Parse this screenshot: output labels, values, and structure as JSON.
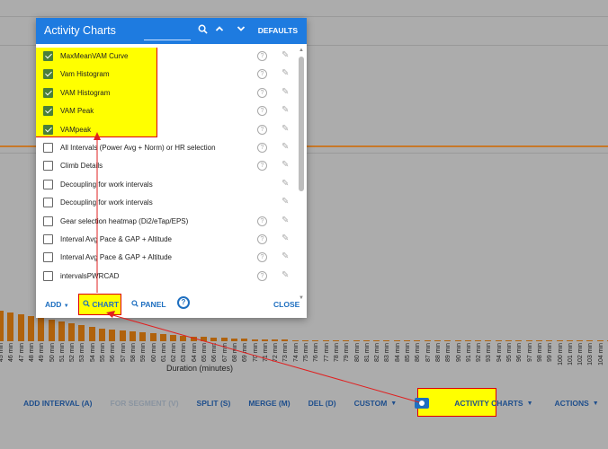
{
  "chart_data": {
    "type": "bar",
    "xlabel": "Duration (minutes)",
    "categories": [
      "45 min",
      "46 min",
      "47 min",
      "48 min",
      "49 min",
      "50 min",
      "51 min",
      "52 min",
      "53 min",
      "54 min",
      "55 min",
      "56 min",
      "57 min",
      "58 min",
      "59 min",
      "60 min",
      "61 min",
      "62 min",
      "63 min",
      "64 min",
      "65 min",
      "66 min",
      "67 min",
      "68 min",
      "69 min",
      "70 min",
      "71 min",
      "72 min",
      "73 min",
      "74 min",
      "75 min",
      "76 min",
      "77 min",
      "78 min",
      "79 min",
      "80 min",
      "81 min",
      "82 min",
      "83 min",
      "84 min",
      "85 min",
      "86 min",
      "87 min",
      "88 min",
      "89 min",
      "90 min",
      "91 min",
      "92 min",
      "93 min",
      "94 min",
      "95 min",
      "96 min",
      "97 min",
      "98 min",
      "99 min",
      "100 min",
      "101 min",
      "102 min",
      "103 min",
      "104 min",
      "105 min",
      "106 min"
    ],
    "values": [
      34,
      32,
      30,
      28,
      26,
      24,
      22,
      20,
      18,
      16,
      14,
      13,
      12,
      11,
      10,
      9,
      8,
      7,
      6,
      5.5,
      5,
      4.5,
      4,
      3.5,
      3,
      2.5,
      2,
      1.8,
      1.6,
      1.4,
      1.2,
      1,
      1,
      1,
      1,
      1,
      1,
      1,
      1,
      1,
      1,
      1,
      1,
      1,
      1,
      1,
      1,
      1,
      1,
      1,
      1,
      1,
      1,
      1,
      1,
      1,
      1,
      1,
      1,
      1,
      1,
      1
    ]
  },
  "toolbar": {
    "add_interval": "ADD INTERVAL (A)",
    "for_segment": "FOR SEGMENT (V)",
    "split": "SPLIT (S)",
    "merge": "MERGE (M)",
    "del": "DEL (D)",
    "custom": "CUSTOM",
    "activity_charts": "ACTIVITY CHARTS",
    "actions": "ACTIONS"
  },
  "dialog": {
    "title": "Activity Charts",
    "defaults": "DEFAULTS",
    "items": [
      {
        "label": "MaxMeanVAM Curve",
        "checked": true,
        "help": true
      },
      {
        "label": "Vam Histogram",
        "checked": true,
        "help": true
      },
      {
        "label": "VAM Histogram",
        "checked": true,
        "help": true
      },
      {
        "label": "VAM Peak",
        "checked": true,
        "help": true
      },
      {
        "label": "VAMpeak",
        "checked": true,
        "help": true
      },
      {
        "label": "All Intervals (Power Avg + Norm) or HR selection",
        "checked": false,
        "help": true
      },
      {
        "label": "Climb Details",
        "checked": false,
        "help": true
      },
      {
        "label": "Decoupling for work intervals",
        "checked": false,
        "help": false
      },
      {
        "label": "Decoupling for work intervals",
        "checked": false,
        "help": false
      },
      {
        "label": "Gear selection heatmap (Di2/eTap/EPS)",
        "checked": false,
        "help": true
      },
      {
        "label": "Interval Avg Pace & GAP + Altitude",
        "checked": false,
        "help": true
      },
      {
        "label": "Interval Avg Pace & GAP + Altitude",
        "checked": false,
        "help": true
      },
      {
        "label": "intervalsPWRCAD",
        "checked": false,
        "help": true
      }
    ],
    "footer": {
      "add": "ADD",
      "chart": "CHART",
      "panel": "PANEL",
      "help": "?",
      "close": "CLOSE"
    }
  },
  "colors": {
    "accent": "#1e7be0",
    "highlight": "#ffff00",
    "bars": "#b0620c"
  }
}
